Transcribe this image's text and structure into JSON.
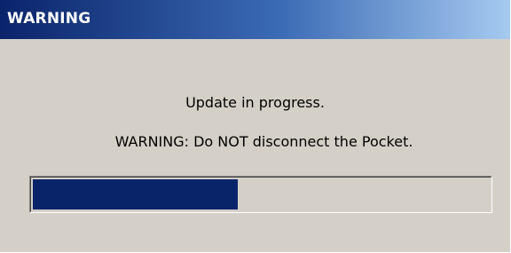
{
  "dialog": {
    "title": "WARNING",
    "line1": "Update in progress.",
    "line2": "WARNING:  Do NOT disconnect the Pocket.",
    "progress_fraction": 0.45
  },
  "colors": {
    "titlebar_start": "#0a246a",
    "titlebar_end": "#a6caf0",
    "dialog_bg": "#d4d0c8",
    "progress_fill": "#0a246a"
  }
}
